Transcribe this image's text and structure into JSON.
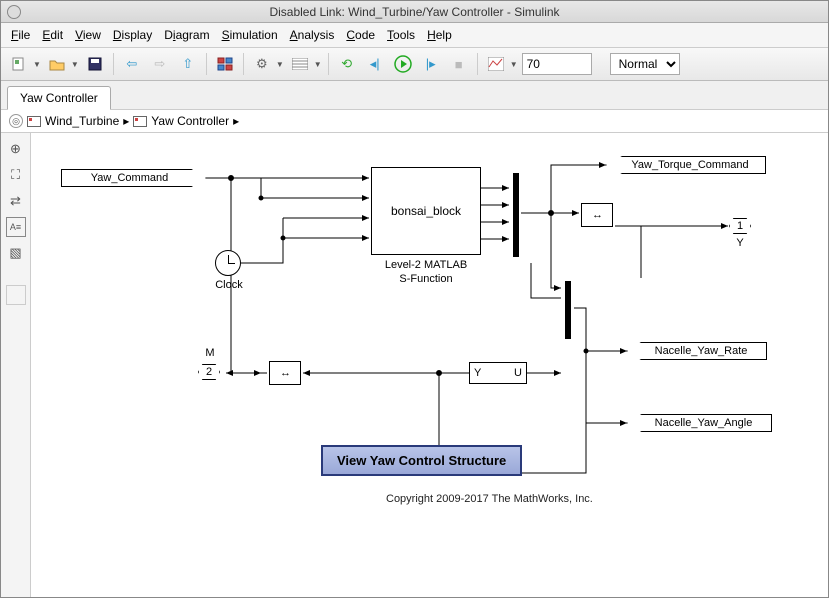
{
  "window": {
    "title": "Disabled Link: Wind_Turbine/Yaw Controller - Simulink"
  },
  "menu": {
    "file": "File",
    "edit": "Edit",
    "view": "View",
    "display": "Display",
    "diagram": "Diagram",
    "simulation": "Simulation",
    "analysis": "Analysis",
    "code": "Code",
    "tools": "Tools",
    "help": "Help"
  },
  "toolbar": {
    "stop_time": "70",
    "mode": "Normal"
  },
  "tab": {
    "label": "Yaw Controller"
  },
  "breadcrumb": {
    "root": "Wind_Turbine",
    "sub": "Yaw Controller"
  },
  "blocks": {
    "yaw_command": "Yaw_Command",
    "bonsai": "bonsai_block",
    "bonsai_caption1": "Level-2 MATLAB",
    "bonsai_caption2": "S-Function",
    "clock": "Clock",
    "yaw_torque": "Yaw_Torque_Command",
    "outport_y": "Y",
    "nacelle_rate": "Nacelle_Yaw_Rate",
    "nacelle_angle": "Nacelle_Yaw_Angle",
    "y_label": "Y",
    "u_label": "U",
    "m_label": "M",
    "port1": "1",
    "port2": "2"
  },
  "button": {
    "view_structure": "View Yaw Control Structure"
  },
  "footer": {
    "copyright": "Copyright 2009-2017 The MathWorks, Inc."
  }
}
